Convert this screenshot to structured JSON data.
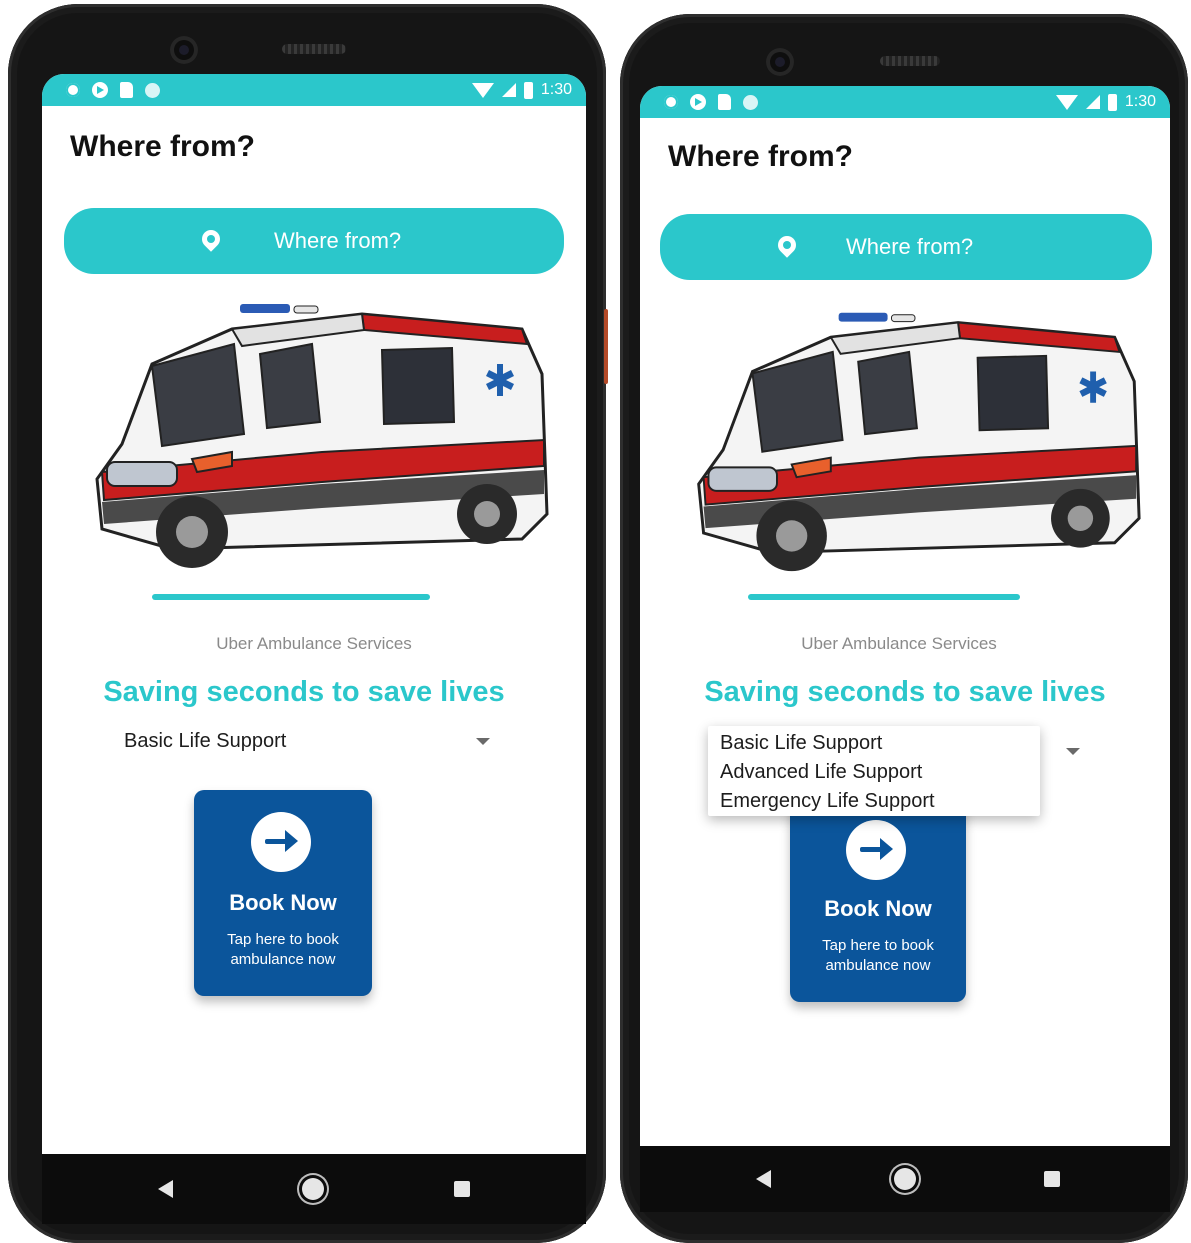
{
  "colors": {
    "accent": "#2bc7cb",
    "book_card": "#0b559b",
    "nav_bar": "#0c0c0c",
    "ambulance_stripe": "#c81e1e"
  },
  "status_bar": {
    "time": "1:30",
    "icons": [
      "settings-icon",
      "play-icon",
      "sd-card-icon",
      "dot-icon",
      "wifi-icon",
      "signal-icon",
      "battery-icon"
    ]
  },
  "screens": [
    {
      "page_title": "Where from?",
      "search": {
        "placeholder": "Where from?",
        "icon": "location-pin-icon"
      },
      "brand_label": "Uber Ambulance Services",
      "tagline": "Saving seconds to save lives",
      "spinner": {
        "selected": "Basic Life Support",
        "expanded": false
      },
      "book_card": {
        "title": "Book Now",
        "subtitle_line1": "Tap here to book",
        "subtitle_line2": "ambulance now",
        "icon": "arrow-right-icon"
      }
    },
    {
      "page_title": "Where from?",
      "search": {
        "placeholder": "Where from?",
        "icon": "location-pin-icon"
      },
      "brand_label": "Uber Ambulance Services",
      "tagline": "Saving seconds to save lives",
      "spinner": {
        "selected": "Basic Life Support",
        "expanded": true,
        "options": [
          "Basic Life Support",
          "Advanced Life Support",
          "Emergency Life Support"
        ]
      },
      "book_card": {
        "title": "Book Now",
        "subtitle_line1": "Tap here to book",
        "subtitle_line2": "ambulance now",
        "icon": "arrow-right-icon"
      }
    }
  ],
  "nav_bar": {
    "buttons": [
      "back-icon",
      "home-icon",
      "recents-icon"
    ]
  }
}
